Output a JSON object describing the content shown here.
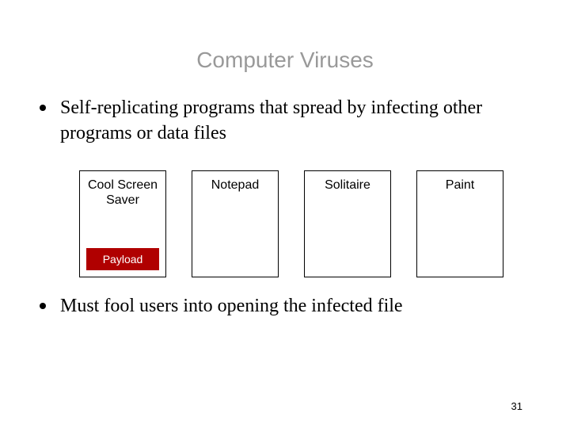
{
  "title": "Computer Viruses",
  "bullets": [
    "Self-replicating programs that spread by infecting other programs or data files",
    "Must fool users into opening the infected file"
  ],
  "boxes": [
    {
      "label": "Cool Screen Saver",
      "payload": "Payload"
    },
    {
      "label": "Notepad",
      "payload": null
    },
    {
      "label": "Solitaire",
      "payload": null
    },
    {
      "label": "Paint",
      "payload": null
    }
  ],
  "pageNumber": "31"
}
